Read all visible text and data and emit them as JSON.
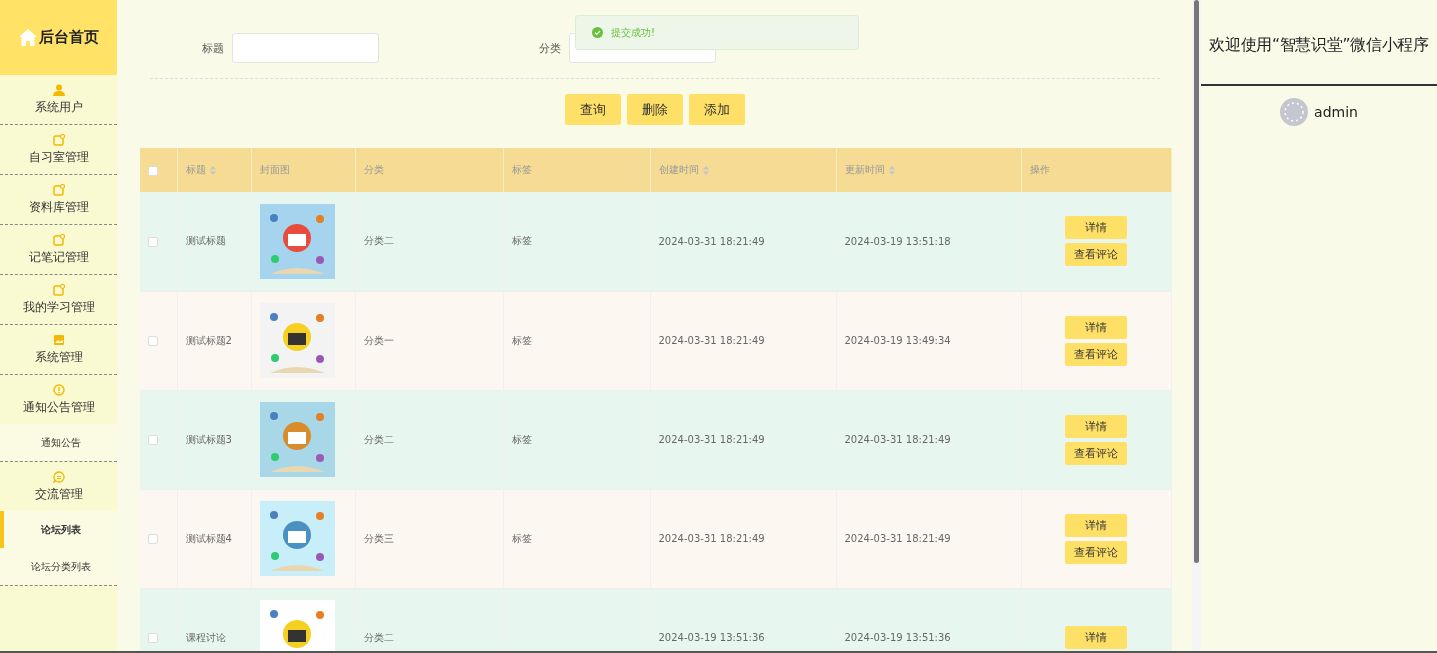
{
  "sidebar": {
    "brand": "后台首页",
    "items": [
      {
        "label": "系统用户"
      },
      {
        "label": "自习室管理"
      },
      {
        "label": "资料库管理"
      },
      {
        "label": "记笔记管理"
      },
      {
        "label": "我的学习管理"
      },
      {
        "label": "系统管理"
      },
      {
        "label": "通知公告管理",
        "children": [
          {
            "label": "通知公告",
            "selected": false
          }
        ]
      },
      {
        "label": "交流管理",
        "children": [
          {
            "label": "论坛列表",
            "selected": true
          },
          {
            "label": "论坛分类列表",
            "selected": false
          }
        ]
      }
    ]
  },
  "filters": [
    {
      "label": "标题"
    },
    {
      "label": "分类"
    }
  ],
  "toast": {
    "text": "提交成功!"
  },
  "buttons": [
    "查询",
    "删除",
    "添加"
  ],
  "table": {
    "all_checked": false,
    "columns": [
      {
        "label": "标题",
        "sortable": true
      },
      {
        "label": "封面图",
        "sortable": false
      },
      {
        "label": "分类",
        "sortable": false
      },
      {
        "label": "标签",
        "sortable": false
      },
      {
        "label": "创建时间",
        "sortable": true
      },
      {
        "label": "更新时间",
        "sortable": true
      },
      {
        "label": "操作",
        "sortable": false
      }
    ],
    "rows": [
      {
        "title": "测试标题",
        "cover": {
          "kind": "picture"
        },
        "category": "分类二",
        "tag": "标签",
        "created": "2024-03-31 18:21:49",
        "updated": "2024-03-19 13:51:18",
        "actions": [
          "详情",
          "查看评论"
        ],
        "checked": false
      },
      {
        "title": "测试标题2",
        "cover": {
          "kind": "picture"
        },
        "category": "分类一",
        "tag": "标签",
        "created": "2024-03-31 18:21:49",
        "updated": "2024-03-19 13:49:34",
        "actions": [
          "详情",
          "查看评论"
        ],
        "checked": false
      },
      {
        "title": "测试标题3",
        "cover": {
          "kind": "picture"
        },
        "category": "分类二",
        "tag": "标签",
        "created": "2024-03-31 18:21:49",
        "updated": "2024-03-31 18:21:49",
        "actions": [
          "详情",
          "查看评论"
        ],
        "checked": false
      },
      {
        "title": "测试标题4",
        "cover": {
          "kind": "picture"
        },
        "category": "分类三",
        "tag": "标签",
        "created": "2024-03-31 18:21:49",
        "updated": "2024-03-31 18:21:49",
        "actions": [
          "详情",
          "查看评论"
        ],
        "checked": false
      },
      {
        "title": "课程讨论",
        "cover": {
          "kind": "picture"
        },
        "category": "分类二",
        "created": "2024-03-19 13:51:36",
        "updated": "2024-03-19 13:51:36",
        "actions": [
          "详情"
        ],
        "checked": false
      }
    ]
  },
  "welcome": {
    "title": "欢迎使用“智慧识堂”微信小程序",
    "user": "admin"
  }
}
